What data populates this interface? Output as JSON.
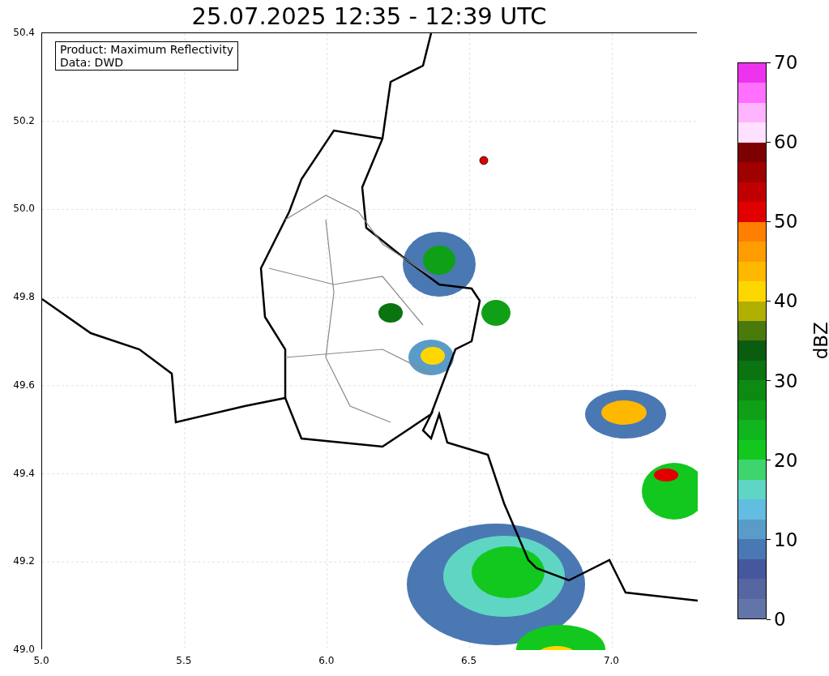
{
  "title": "25.07.2025 12:35 - 12:39 UTC",
  "map": {
    "info_box": [
      "Product: Maximum Reflectivity",
      "Data: DWD"
    ],
    "x_ticks": [
      "5.0",
      "5.5",
      "6.0",
      "6.5",
      "7.0"
    ],
    "y_ticks": [
      "50.4",
      "50.2",
      "50.0",
      "49.8",
      "49.6",
      "49.4",
      "49.2",
      "49.0"
    ]
  },
  "colorbar": {
    "label": "dBZ",
    "ticks": [
      "70",
      "60",
      "50",
      "40",
      "30",
      "20",
      "10",
      "0"
    ],
    "segments": [
      {
        "color": "#6275a8"
      },
      {
        "color": "#5566a0"
      },
      {
        "color": "#45589e"
      },
      {
        "color": "#4a78b2"
      },
      {
        "color": "#5a9cc8"
      },
      {
        "color": "#62bde0"
      },
      {
        "color": "#5fd6c4"
      },
      {
        "color": "#3ed46e"
      },
      {
        "color": "#12c81e"
      },
      {
        "color": "#10b41c"
      },
      {
        "color": "#10a018"
      },
      {
        "color": "#0c8a12"
      },
      {
        "color": "#0a7410"
      },
      {
        "color": "#0a5c0e"
      },
      {
        "color": "#4a7a0c"
      },
      {
        "color": "#b0b000"
      },
      {
        "color": "#ffd700"
      },
      {
        "color": "#ffb800"
      },
      {
        "color": "#ff9c00"
      },
      {
        "color": "#ff7f00"
      },
      {
        "color": "#e00000"
      },
      {
        "color": "#c00000"
      },
      {
        "color": "#a00000"
      },
      {
        "color": "#7d0000"
      },
      {
        "color": "#ffe0ff"
      },
      {
        "color": "#ffb4ff"
      },
      {
        "color": "#ff70ff"
      },
      {
        "color": "#ee33ee"
      }
    ]
  }
}
